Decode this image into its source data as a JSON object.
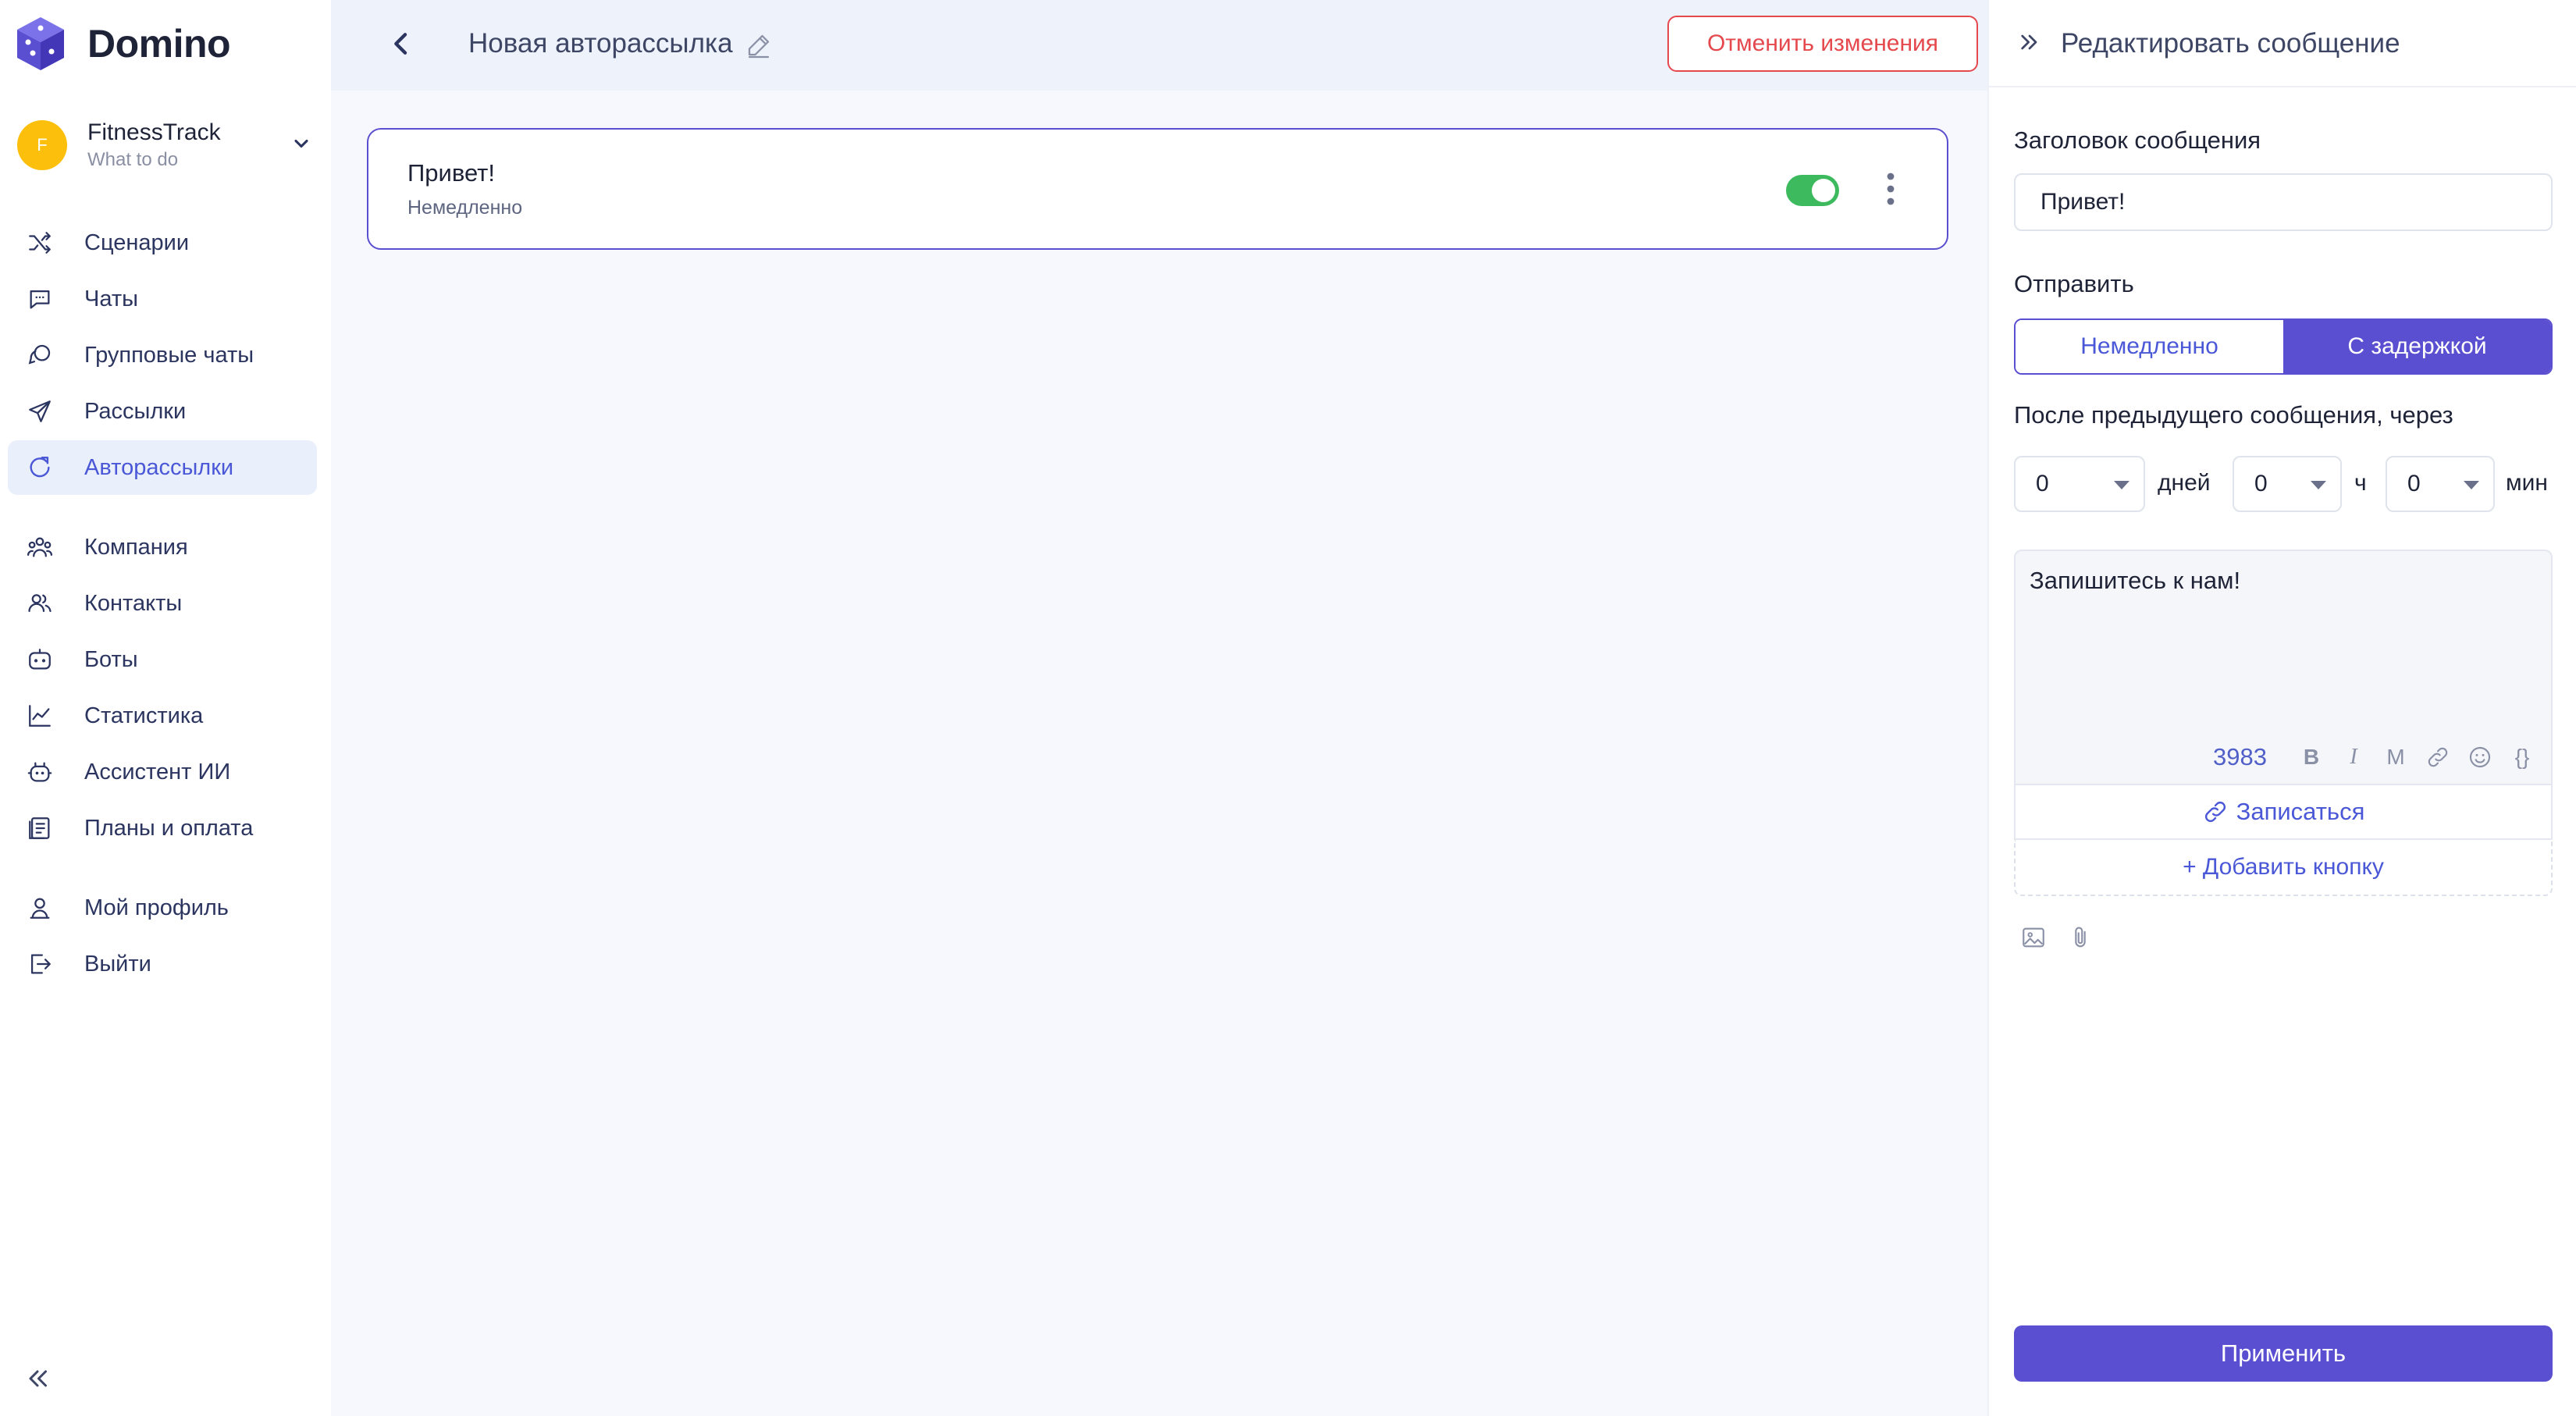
{
  "app": {
    "name": "Domino"
  },
  "account": {
    "initial": "F",
    "name": "FitnessTrack",
    "subtitle": "What to do"
  },
  "nav": {
    "items": [
      {
        "label": "Сценарии",
        "icon": "shuffle-icon"
      },
      {
        "label": "Чаты",
        "icon": "chat-icon"
      },
      {
        "label": "Групповые чаты",
        "icon": "group-chat-icon"
      },
      {
        "label": "Рассылки",
        "icon": "send-icon"
      },
      {
        "label": "Авторассылки",
        "icon": "auto-mailing-icon",
        "active": true
      },
      {
        "label": "Компания",
        "icon": "company-icon"
      },
      {
        "label": "Контакты",
        "icon": "contacts-icon"
      },
      {
        "label": "Боты",
        "icon": "bot-icon"
      },
      {
        "label": "Статистика",
        "icon": "chart-icon"
      },
      {
        "label": "Ассистент ИИ",
        "icon": "ai-assistant-icon"
      },
      {
        "label": "Планы и оплата",
        "icon": "billing-icon"
      },
      {
        "label": "Мой профиль",
        "icon": "user-icon"
      },
      {
        "label": "Выйти",
        "icon": "logout-icon"
      }
    ]
  },
  "header": {
    "title": "Новая авторассылка",
    "cancel_label": "Отменить изменения"
  },
  "message_card": {
    "title": "Привет!",
    "timing": "Немедленно",
    "enabled": true
  },
  "panel": {
    "title": "Редактировать сообщение",
    "heading_label": "Заголовок сообщения",
    "heading_value": "Привет!",
    "send_label": "Отправить",
    "send_options": [
      "Немедленно",
      "С задержкой"
    ],
    "send_selected": "С задержкой",
    "delay_label": "После предыдущего сообщения, через",
    "delay": {
      "days": "0",
      "days_unit": "дней",
      "hours": "0",
      "hours_unit": "ч",
      "minutes": "0",
      "minutes_unit": "мин"
    },
    "message_text": "Запишитесь к нам!",
    "char_count": "3983",
    "format_bold": "B",
    "format_italic": "I",
    "format_mono": "M",
    "format_vars": "{}",
    "link_button_label": "Записаться",
    "add_button_label": "+ Добавить кнопку",
    "apply_label": "Применить"
  },
  "colors": {
    "accent": "#5b4fd1",
    "active_nav_bg": "#eaf0fb",
    "danger": "#e5484d",
    "toggle_on": "#3cba5d",
    "avatar": "#fcbf0b"
  }
}
